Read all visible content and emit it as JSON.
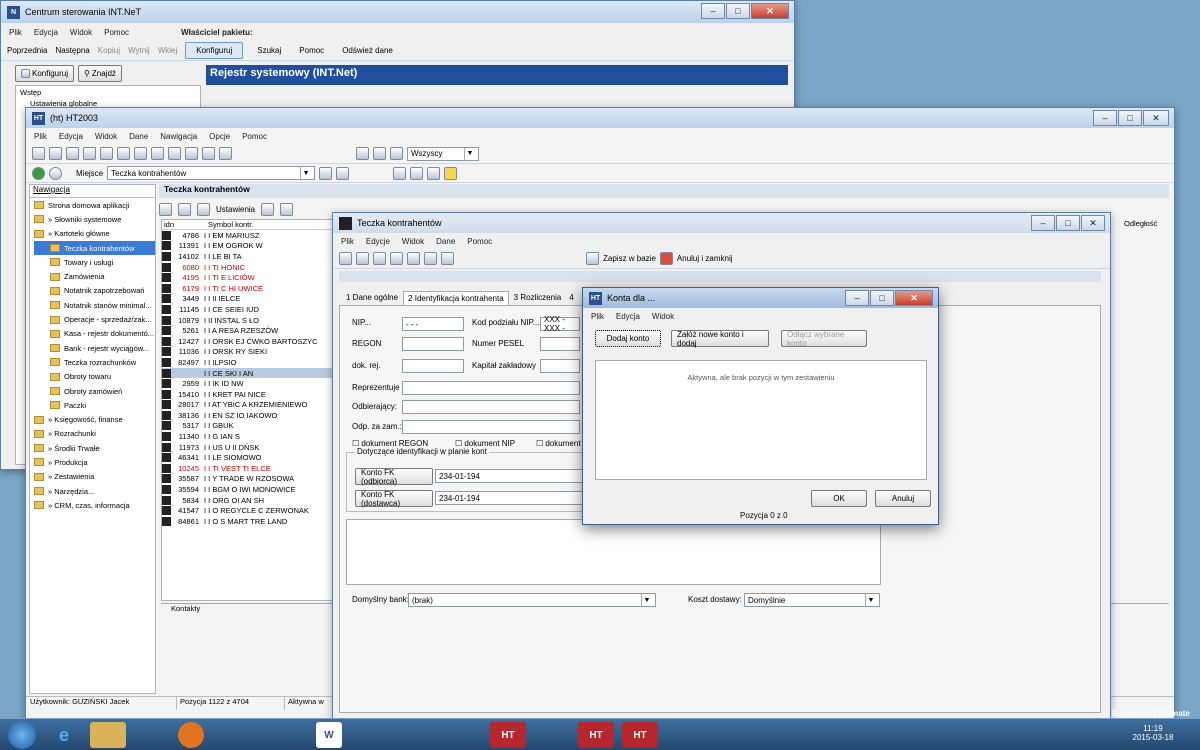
{
  "win1": {
    "title": "Centrum sterowania INT.NeT",
    "menu": [
      "Plik",
      "Edycja",
      "Widok",
      "Pomoc"
    ],
    "owner_label": "Właściciel pakietu:",
    "tools": [
      "Poprzednia",
      "Następna",
      "Kopiuj",
      "Wytnij",
      "Wklej",
      "Konfiguruj",
      "Szukaj",
      "Pomoc",
      "Odśwież dane"
    ],
    "tab_konfig": "Konfiguruj",
    "tab_find": "Znajdź",
    "tree": [
      "Wstęp",
      "Ustawienia globalne"
    ],
    "banner": "Rejestr systemowy (INT.Net)"
  },
  "win2": {
    "title": "(ht)  HT2003",
    "menu": [
      "Plik",
      "Edycja",
      "Widok",
      "Dane",
      "Nawigacja",
      "Opcje",
      "Pomoc"
    ],
    "filter": "Wszyscy",
    "place_label": "Miejsce",
    "place_value": "Teczka kontrahentów",
    "nav_header": "Nawigacja",
    "nav": [
      "Strona domowa aplikacji",
      "» Słowniki systemowe",
      "» Kartoteki główne",
      "Teczka kontrahentów",
      "Towary i usługi",
      "Zamówienia",
      "Notatnik zapotrzebowań",
      "Notatnik stanów minimal...",
      "Operacje - sprzedaż/zak...",
      "Kasa - rejestr dokumentó...",
      "Bank - rejestr wyciągów...",
      "Teczka rozrachunków",
      "Obroty towaru",
      "Obroty zamówień",
      "Paczki",
      "» Księgowość, finanse",
      "» Rozrachunki",
      "» Środki Trwałe",
      "» Produkcja",
      "» Zestawienia",
      "» Narzędzia...",
      "» CRM, czas, informacja"
    ],
    "main_title": "Teczka kontrahentów",
    "settings_label": "Ustawienia",
    "col_idn": "idn",
    "col_symbol": "Symbol kontr.",
    "col_odleglosc": "Odległość",
    "rows": [
      [
        "4786",
        "I I EM  MARIUSZ"
      ],
      [
        "11391",
        "I I EM  OGROK  W"
      ],
      [
        "14102",
        "I I LE  BI  TA"
      ],
      [
        "6080",
        "I I TI HONIC"
      ],
      [
        "4195",
        "I I TI E LICIÓW"
      ],
      [
        "6179",
        "I I TI C HI UWICE"
      ],
      [
        "3449",
        "I I II IELCE"
      ],
      [
        "11145",
        "I I CE SEIEI IUD"
      ],
      [
        "10879",
        "I II INSTAL S  ŁO"
      ],
      [
        "5261",
        "I I A RESA  RZESZÓW"
      ],
      [
        "12427",
        "I I ORSK  EJ ĆWKO BARTOSZYC"
      ],
      [
        "11036",
        "I I ORSK  RY SIEKI"
      ],
      [
        "82497",
        "I I ILPSIO"
      ],
      [
        "",
        "I I CE  SKI I AN"
      ],
      [
        "2959",
        "I I IK  ID  NW"
      ],
      [
        "15410",
        "I I KRET PAI NICE"
      ],
      [
        "28017",
        "I I AT YBIC A KRZEMIENIEWO"
      ],
      [
        "38136",
        "I I EN SZ IO IAKOWO"
      ],
      [
        "5317",
        "I I GBUK"
      ],
      [
        "11340",
        "I I G  IAN S"
      ],
      [
        "11973",
        "I I US  U II  DŃSK"
      ],
      [
        "46341",
        "I I LE SIOMOWO"
      ],
      [
        "10245",
        "I I TI VEST TI ELCE"
      ],
      [
        "35587",
        "I I Y TRADE W  RZOSOWA"
      ],
      [
        "35594",
        "I I BGM  O  IWI MONOWICE"
      ],
      [
        "5834",
        "I I ORG  OI AN SH"
      ],
      [
        "41547",
        "I I O REGYCLE C ZERWONAK"
      ],
      [
        "84861",
        "I I O S  MART TRE LAND"
      ]
    ],
    "contacts_label": "Kontakty",
    "status_user": "Użytkownik: GUZIŃSKI Jacek",
    "status_pos": "Pozycja 1122 z 4704",
    "status_active": "Aktywna w"
  },
  "win3": {
    "title": "Teczka kontrahentów",
    "menu": [
      "Plik",
      "Edycje",
      "Widok",
      "Dane",
      "Pomoc"
    ],
    "save": "Zapisz w bazie",
    "cancel_close": "Anuluj i zamknij",
    "tabs": [
      "1 Dane ogólne",
      "2 Identyfikacja kontrahenta",
      "3 Rozliczenia",
      "4"
    ],
    "nip_label": "NIP...",
    "nip_value": "-   -   -",
    "kod_label": "Kod podziału NIP...",
    "kod_value": "XXX - XXX -",
    "regon_label": "REGON",
    "pesel_label": "Numer PESEL",
    "dok_label": "dok. rej.",
    "kapital_label": "Kapitał zakładowy",
    "repr_label": "Reprezentuje",
    "odbier_label": "Odbierający:",
    "odpza_label": "Odp. za zam.:",
    "chk1": "dokument REGON",
    "chk2": "dokument NIP",
    "chk3": "dokument",
    "group_label": "Dotyczące identyfikacji w planie kont",
    "fk_odb": "Konto FK (odbiorca)",
    "fk_dost": "Konto FK (dostawca)",
    "fk_odb_val": "234-01-194",
    "fk_dost_val": "234-01-194",
    "bank_label": "Domyślny bank:",
    "bank_value": "(brak)",
    "koszt_label": "Koszt dostawy:",
    "koszt_value": "Domyślnie"
  },
  "win4": {
    "title": "Konta dla ...",
    "menu": [
      "Plik",
      "Edycja",
      "Widok"
    ],
    "add": "Dodaj konto",
    "create": "Załóż nowe konto i dodaj",
    "detach": "Odłącz wybrane konto",
    "empty": "Aktywna, ale brak pozycji w tym zestawieniu",
    "ok": "OK",
    "cancel": "Anuluj",
    "pos": "Pozycja 0 z 0"
  },
  "taskbar": {
    "time": "11:19",
    "date": "2015-03-18",
    "edition": "Enterprise / Ultimate"
  }
}
